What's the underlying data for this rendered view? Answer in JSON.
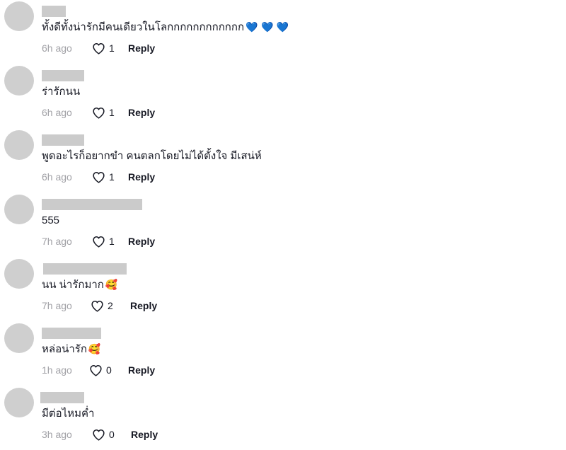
{
  "comments": [
    {
      "text": "ทั้งดีทั้งน่ารักมีคนเดียวในโลกกกกกกกกกกกก",
      "emoji": "💙 💙 💙",
      "time": "6h ago",
      "likes": "1",
      "reply_label": "Reply"
    },
    {
      "text": "ร่ารักนน",
      "emoji": "",
      "time": "6h ago",
      "likes": "1",
      "reply_label": "Reply"
    },
    {
      "text": "พูดอะไรก็อยากขำ คนตลกโดยไม่ได้ตั้งใจ มีเสน่ห์",
      "emoji": "",
      "time": "6h ago",
      "likes": "1",
      "reply_label": "Reply"
    },
    {
      "text": "555",
      "emoji": "",
      "time": "7h ago",
      "likes": "1",
      "reply_label": "Reply"
    },
    {
      "text": "นน น่ารักมาก",
      "emoji": "🥰",
      "time": "7h ago",
      "likes": "2",
      "reply_label": "Reply"
    },
    {
      "text": "หล่อน่ารัก",
      "emoji": "🥰",
      "time": "1h ago",
      "likes": "0",
      "reply_label": "Reply"
    },
    {
      "text": "มีต่อไหมค่ำ",
      "emoji": "",
      "time": "3h ago",
      "likes": "0",
      "reply_label": "Reply"
    }
  ],
  "icons": {
    "like": "heart-outline-icon",
    "avatar": "avatar-placeholder",
    "username": "redacted-username"
  },
  "colors": {
    "text": "#161823",
    "muted": "#a1a1a6",
    "avatar": "#cfcfcf",
    "redaction": "#cbcbcb"
  }
}
